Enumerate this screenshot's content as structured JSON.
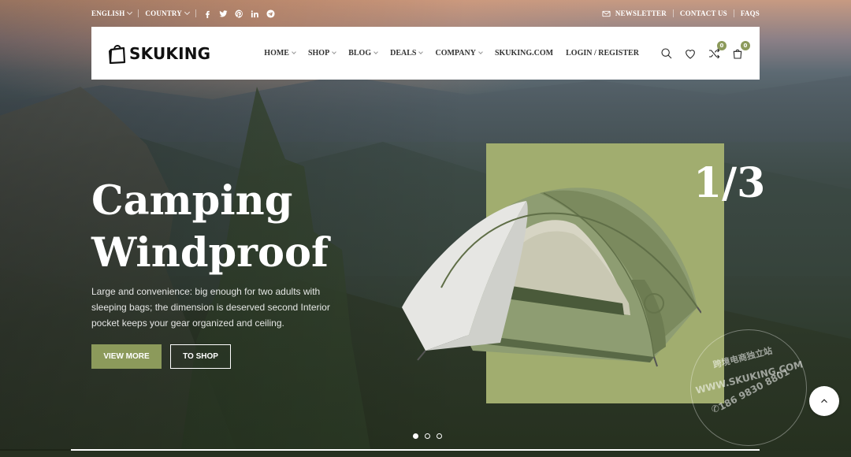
{
  "topbar": {
    "language": "ENGLISH",
    "country": "COUNTRY",
    "socials": [
      "facebook-icon",
      "twitter-icon",
      "pinterest-icon",
      "linkedin-icon",
      "telegram-icon"
    ],
    "newsletter": "NEWSLETTER",
    "contact": "CONTACT US",
    "faqs": "FAQS"
  },
  "header": {
    "logo": "SKUKING",
    "nav": [
      "HOME",
      "SHOP",
      "BLOG",
      "DEALS",
      "COMPANY",
      "SKUKING.COM"
    ],
    "login": "LOGIN / REGISTER",
    "compare_count": "0",
    "cart_count": "0"
  },
  "hero": {
    "title_line1": "Camping",
    "title_line2": "Windproof",
    "description": "Large and convenience: big enough for two adults with sleeping bags; the dimension is deserved second Interior pocket keeps your gear organized and ceiling.",
    "btn_primary": "VIEW MORE",
    "btn_secondary": "TO SHOP",
    "counter": "1/3"
  },
  "watermark": {
    "line1": "跨境电商独立站",
    "line2": "WWW.SKUKING.COM",
    "line3": "186 9830 8801"
  },
  "slider": {
    "total": 3,
    "active": 1
  },
  "colors": {
    "accent": "#8c9a5b",
    "panel": "#a1ad6f"
  }
}
